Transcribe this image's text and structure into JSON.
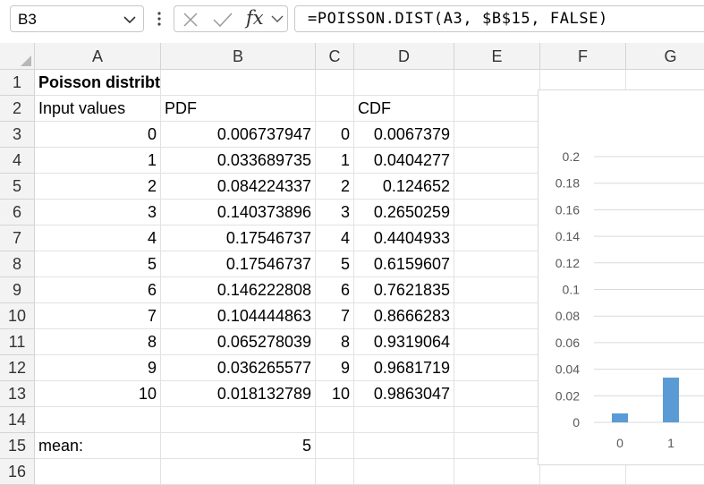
{
  "formula_bar": {
    "name_box": "B3",
    "fx_label": "fx",
    "formula": "=POISSON.DIST(A3, $B$15, FALSE)"
  },
  "columns": [
    "A",
    "B",
    "C",
    "D",
    "E",
    "F",
    "G"
  ],
  "rows": [
    "1",
    "2",
    "3",
    "4",
    "5",
    "6",
    "7",
    "8",
    "9",
    "10",
    "11",
    "12",
    "13",
    "14",
    "15",
    "16"
  ],
  "sheet": {
    "title": "Poisson distribtion",
    "input_header": "Input values",
    "pdf_header": "PDF",
    "cdf_header": "CDF",
    "data": [
      {
        "a": "0",
        "b": "0.006737947",
        "c": "0",
        "d": "0.0067379"
      },
      {
        "a": "1",
        "b": "0.033689735",
        "c": "1",
        "d": "0.0404277"
      },
      {
        "a": "2",
        "b": "0.084224337",
        "c": "2",
        "d": "0.124652"
      },
      {
        "a": "3",
        "b": "0.140373896",
        "c": "3",
        "d": "0.2650259"
      },
      {
        "a": "4",
        "b": "0.17546737",
        "c": "4",
        "d": "0.4404933"
      },
      {
        "a": "5",
        "b": "0.17546737",
        "c": "5",
        "d": "0.6159607"
      },
      {
        "a": "6",
        "b": "0.146222808",
        "c": "6",
        "d": "0.7621835"
      },
      {
        "a": "7",
        "b": "0.104444863",
        "c": "7",
        "d": "0.8666283"
      },
      {
        "a": "8",
        "b": "0.065278039",
        "c": "8",
        "d": "0.9319064"
      },
      {
        "a": "9",
        "b": "0.036265577",
        "c": "9",
        "d": "0.9681719"
      },
      {
        "a": "10",
        "b": "0.018132789",
        "c": "10",
        "d": "0.9863047"
      }
    ],
    "mean_label": "mean:",
    "mean_value": "5"
  },
  "chart_data": {
    "type": "bar",
    "categories": [
      "0",
      "1"
    ],
    "values": [
      0.006737947,
      0.033689735
    ],
    "ylim": [
      0,
      0.2
    ],
    "yticks": [
      "0",
      "0.02",
      "0.04",
      "0.06",
      "0.08",
      "0.1",
      "0.12",
      "0.14",
      "0.16",
      "0.18",
      "0.2"
    ],
    "bar_color": "#5b9bd5",
    "grid": true
  }
}
